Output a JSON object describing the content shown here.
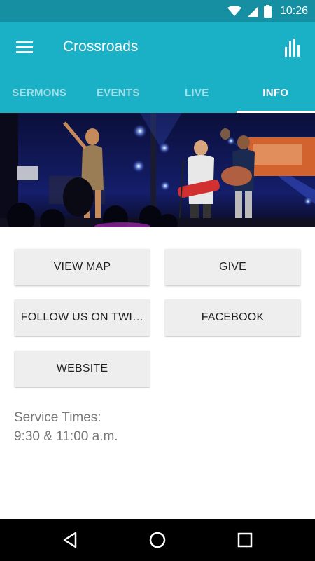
{
  "status_bar": {
    "time": "10:26",
    "icons": [
      "wifi-icon",
      "cell-signal-icon",
      "battery-icon"
    ],
    "color": "#168fa2"
  },
  "app_bar": {
    "title": "Crossroads",
    "left_icon": "menu-icon",
    "right_icon": "bar-chart-icon",
    "color": "#1ab0c5"
  },
  "tabs": [
    {
      "label": "SERMONS",
      "active": false
    },
    {
      "label": "EVENTS",
      "active": false
    },
    {
      "label": "LIVE",
      "active": false
    },
    {
      "label": "INFO",
      "active": true
    }
  ],
  "buttons": {
    "view_map": "VIEW MAP",
    "give": "GIVE",
    "twitter": "FOLLOW US ON TWI…",
    "facebook": "FACEBOOK",
    "website": "WEBSITE"
  },
  "info": {
    "line1": "Service Times:",
    "line2": "9:30 & 11:00 a.m."
  },
  "nav_bar": {
    "icons": [
      "back-icon",
      "home-icon",
      "recents-icon"
    ]
  }
}
